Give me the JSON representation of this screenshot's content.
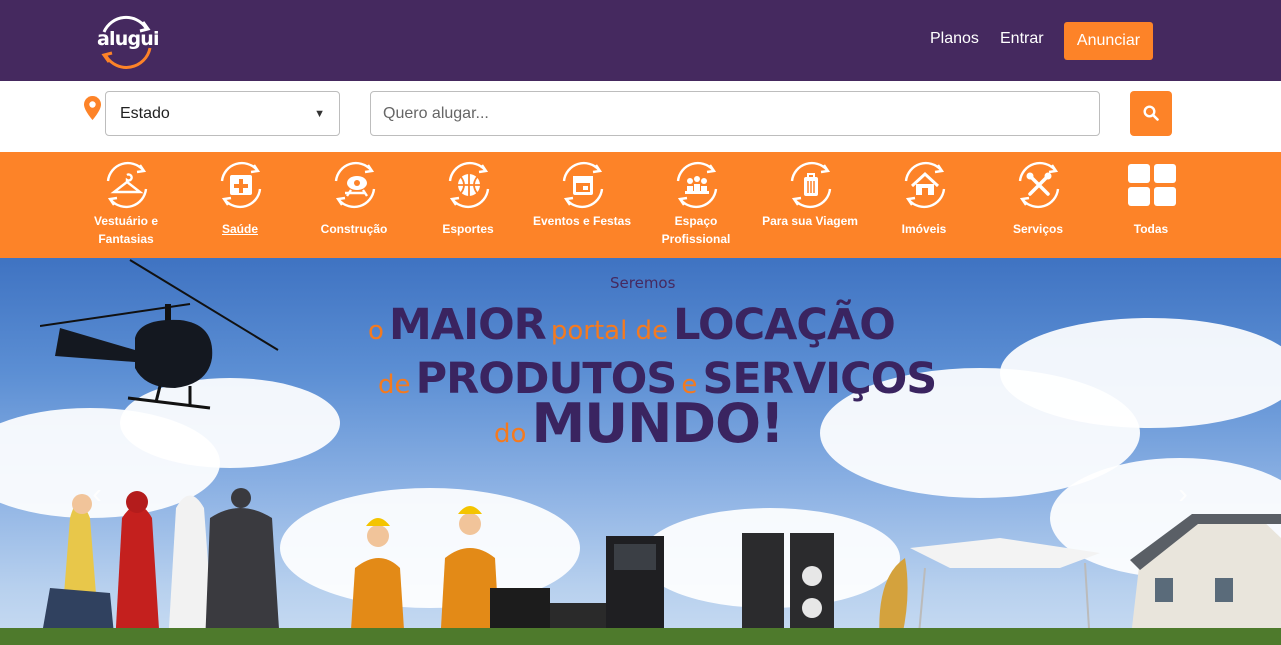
{
  "header": {
    "logo_text": "alugui",
    "nav": {
      "planos": "Planos",
      "entrar": "Entrar"
    },
    "anunciar_label": "Anunciar",
    "colors": {
      "header_bg": "#45295f",
      "accent": "#fd8328"
    }
  },
  "search": {
    "state_select_value": "Estado",
    "query_placeholder": "Quero alugar...",
    "icons": {
      "location": "map-marker-icon",
      "submit": "search-icon"
    }
  },
  "categories": [
    {
      "label": "Vestuário e Fantasias",
      "icon": "hanger-icon"
    },
    {
      "label": "Saúde",
      "icon": "medical-kit-icon"
    },
    {
      "label": "Construção",
      "icon": "cement-mixer-icon"
    },
    {
      "label": "Esportes",
      "icon": "basketball-icon"
    },
    {
      "label": "Eventos e Festas",
      "icon": "calendar-icon"
    },
    {
      "label": "Espaço Profissional",
      "icon": "meeting-people-icon"
    },
    {
      "label": "Para sua Viagem",
      "icon": "luggage-icon"
    },
    {
      "label": "Imóveis",
      "icon": "house-icon"
    },
    {
      "label": "Serviços",
      "icon": "tools-icon"
    },
    {
      "label": "Todas",
      "icon": "grid-icon"
    }
  ],
  "banner": {
    "kicker": "Seremos",
    "line1": {
      "a": "o",
      "b": "MAIOR",
      "c": "portal de",
      "d": "LOCAÇÃO"
    },
    "line2": {
      "a": "de",
      "b": "PRODUTOS",
      "c": "e",
      "d": "SERVIÇOS"
    },
    "line3": {
      "a": "do",
      "b": "MUNDO!"
    },
    "prev_icon": "chevron-left-icon",
    "next_icon": "chevron-right-icon"
  }
}
